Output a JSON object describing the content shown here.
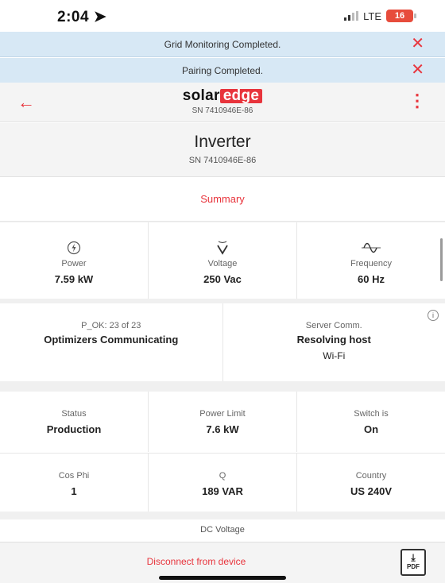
{
  "status_bar": {
    "time": "2:04",
    "network": "LTE",
    "battery": "16"
  },
  "banners": [
    {
      "text": "Grid Monitoring Completed.",
      "close": "✕"
    },
    {
      "text": "Pairing Completed.",
      "close": "✕"
    }
  ],
  "header": {
    "logo_solar": "solar",
    "logo_edge": "edge",
    "serial": "SN 7410946E-86"
  },
  "device": {
    "title": "Inverter",
    "serial": "SN 7410946E-86"
  },
  "summary_link": "Summary",
  "metrics": [
    {
      "label": "Power",
      "value": "7.59 kW",
      "icon": "power-bolt-icon"
    },
    {
      "label": "Voltage",
      "value": "250 Vac",
      "icon": "voltage-icon"
    },
    {
      "label": "Frequency",
      "value": "60 Hz",
      "icon": "frequency-wave-icon"
    }
  ],
  "comm": {
    "optimizers_label": "P_OK: 23 of 23",
    "optimizers_value": "Optimizers Communicating",
    "server_label": "Server Comm.",
    "server_value": "Resolving host",
    "server_sub": "Wi-Fi"
  },
  "details": [
    {
      "label": "Status",
      "value": "Production"
    },
    {
      "label": "Power Limit",
      "value": "7.6 kW"
    },
    {
      "label": "Switch is",
      "value": "On"
    },
    {
      "label": "Cos Phi",
      "value": "1"
    },
    {
      "label": "Q",
      "value": "189 VAR"
    },
    {
      "label": "Country",
      "value": "US 240V"
    }
  ],
  "dc_voltage_label": "DC Voltage",
  "footer": {
    "disconnect": "Disconnect from device",
    "pdf_label": "PDF"
  },
  "colors": {
    "accent": "#e8343c",
    "banner": "#d7e8f5",
    "panel": "#f4f4f4"
  }
}
